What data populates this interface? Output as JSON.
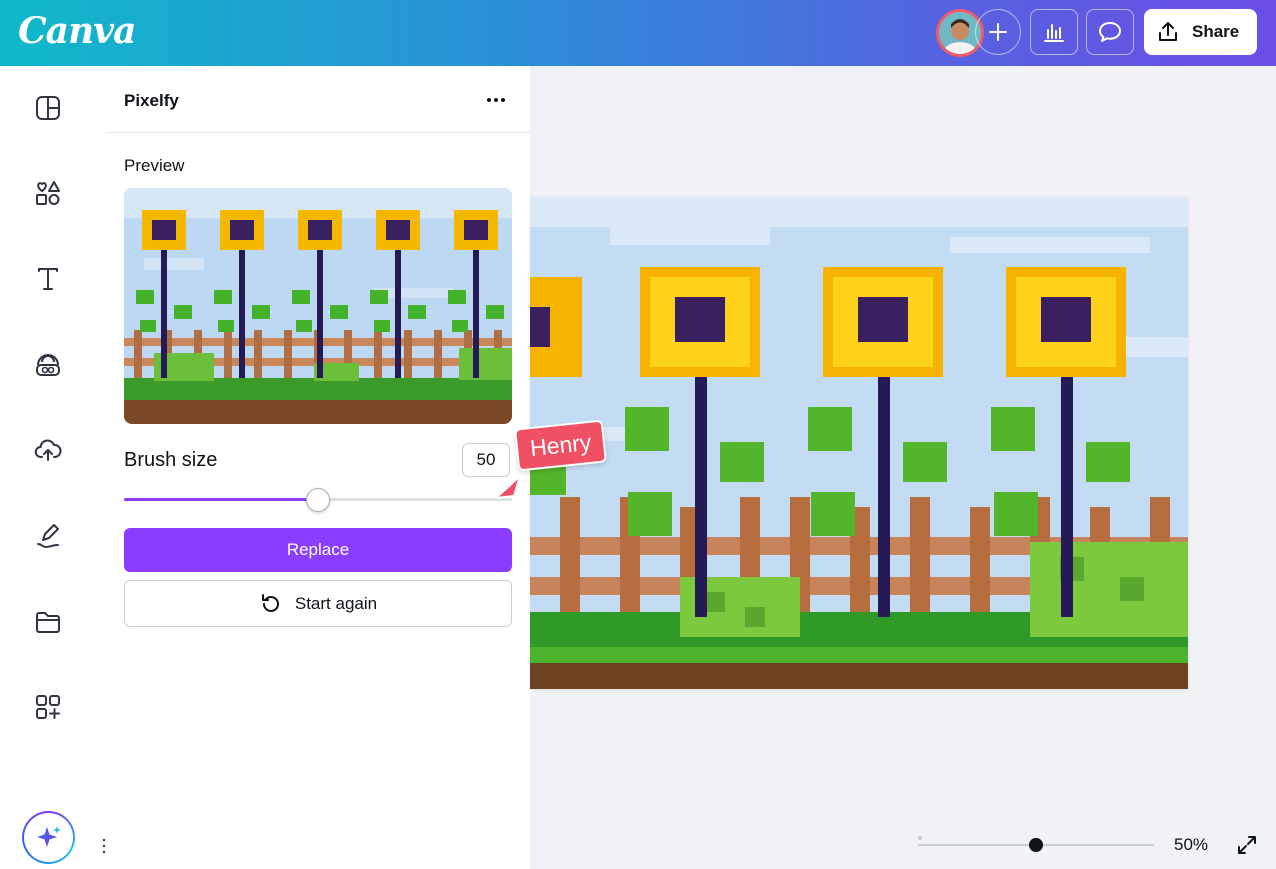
{
  "app": {
    "logo": "Canva"
  },
  "header": {
    "share_label": "Share",
    "icons": [
      "avatar",
      "plus-icon",
      "analytics-icon",
      "comment-icon",
      "share-icon"
    ]
  },
  "rail": {
    "icons": [
      "design-icon",
      "elements-icon",
      "text-icon",
      "brand-icon",
      "uploads-icon",
      "draw-icon",
      "projects-icon",
      "apps-icon"
    ],
    "magic_icon": "sparkle-icon"
  },
  "panel": {
    "title": "Pixelfy",
    "preview_label": "Preview",
    "brush_label": "Brush size",
    "brush_value": "50",
    "brush_fraction": 0.5,
    "replace_label": "Replace",
    "start_again_label": "Start again"
  },
  "collaborator": {
    "name": "Henry"
  },
  "zoom": {
    "label": "50%",
    "fraction": 0.5
  },
  "colors": {
    "accent": "#8b3dff",
    "collaborator": "#f05064",
    "header_start": "#10b9c9",
    "header_end": "#6c4de6"
  }
}
